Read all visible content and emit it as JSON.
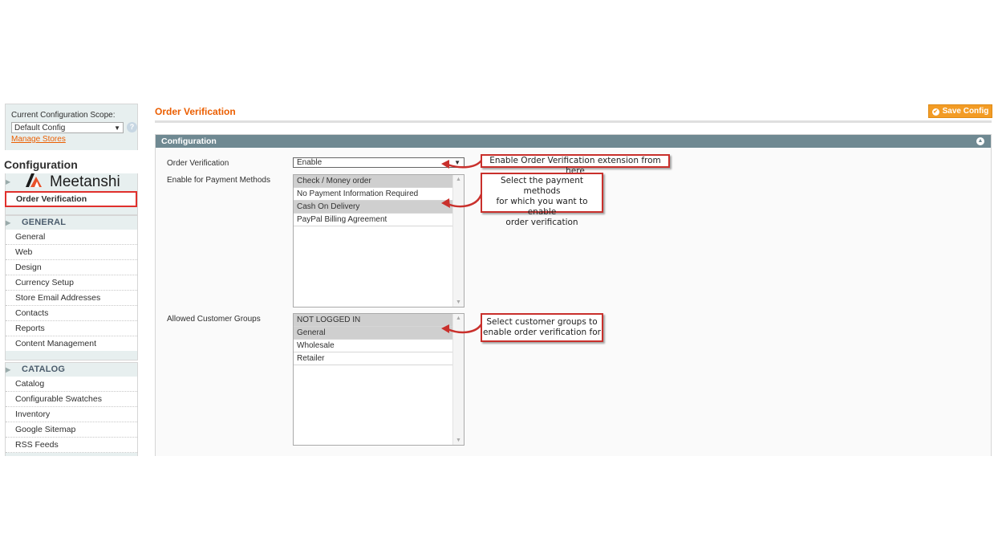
{
  "scope": {
    "label": "Current Configuration Scope:",
    "selected": "Default Config",
    "manage_link": "Manage Stores"
  },
  "sidebar": {
    "title": "Configuration",
    "brand": "Meetanshi",
    "brand_item": "Order Verification",
    "groups": [
      {
        "name": "GENERAL",
        "items": [
          "General",
          "Web",
          "Design",
          "Currency Setup",
          "Store Email Addresses",
          "Contacts",
          "Reports",
          "Content Management"
        ]
      },
      {
        "name": "CATALOG",
        "items": [
          "Catalog",
          "Configurable Swatches",
          "Inventory",
          "Google Sitemap",
          "RSS Feeds"
        ]
      }
    ]
  },
  "main": {
    "title": "Order Verification",
    "save_label": "Save Config",
    "section_title": "Configuration",
    "fields": {
      "order_verification": {
        "label": "Order Verification",
        "value": "Enable"
      },
      "payment_methods": {
        "label": "Enable for Payment Methods",
        "options": [
          {
            "text": "Check / Money order",
            "selected": true
          },
          {
            "text": "No Payment Information Required",
            "selected": false
          },
          {
            "text": "Cash On Delivery",
            "selected": true
          },
          {
            "text": "PayPal Billing Agreement",
            "selected": false
          }
        ]
      },
      "customer_groups": {
        "label": "Allowed Customer Groups",
        "options": [
          {
            "text": "NOT LOGGED IN",
            "selected": true
          },
          {
            "text": "General",
            "selected": true
          },
          {
            "text": "Wholesale",
            "selected": false
          },
          {
            "text": "Retailer",
            "selected": false
          }
        ]
      }
    }
  },
  "callouts": {
    "c1": "Enable Order Verification extension from here",
    "c2": [
      "Select the payment methods",
      "for which you want to enable",
      "order verification"
    ],
    "c3": [
      "Select customer groups to",
      "enable order verification for"
    ]
  },
  "colors": {
    "accent": "#eb5e00",
    "button": "#f39c25",
    "section_head": "#6f8992",
    "callout_border": "#c9302c"
  }
}
